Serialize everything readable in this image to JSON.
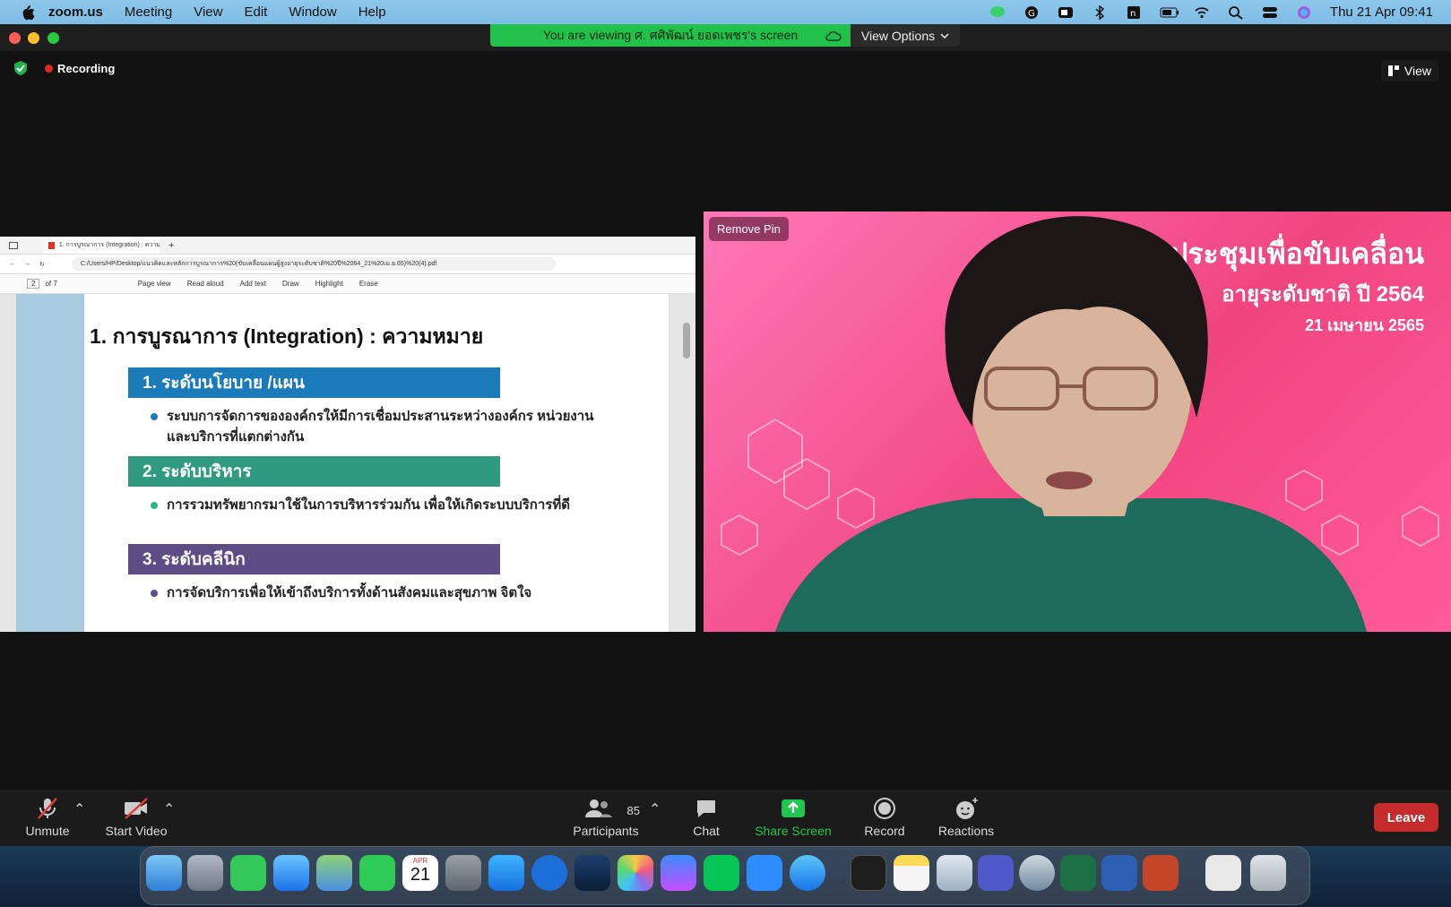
{
  "menubar": {
    "app_name": "zoom.us",
    "menus": [
      "Meeting",
      "View",
      "Edit",
      "Window",
      "Help"
    ],
    "clock": "Thu 21 Apr  09:41"
  },
  "zoom": {
    "banner": "You are viewing ศ. ศศิพัฒน์ ยอดเพชร's screen",
    "view_options": "View Options",
    "recording": "Recording",
    "view_button": "View",
    "remove_pin": "Remove Pin"
  },
  "shared_screen": {
    "url": "C:/Users/HP/Desktop/แนวคิดและหลักการบูรณาการ%20(ขับเคลื่อนแผนผู้สูงอายุระดับชาติ%20ปี%2064_21%20เม.ย.65)%20(4).pdf",
    "page": "2",
    "page_total": "of 7",
    "pdf_tools": [
      "Page view",
      "Read aloud",
      "Add text",
      "Draw",
      "Highlight",
      "Erase"
    ],
    "slide_title": "1. การบูรณาการ (Integration) : ความหมาย",
    "sections": [
      {
        "heading": "1. ระดับนโยบาย /แผน",
        "color": "#1b7ab8",
        "bullet": "ระบบการจัดการขององค์กรให้มีการเชื่อมประสานระหว่างองค์กร หน่วยงาน และบริการที่แตกต่างกัน",
        "bullet_color": "#1b7ab8"
      },
      {
        "heading": "2. ระดับบริหาร",
        "color": "#2f9a7f",
        "bullet": "การรวมทรัพยากรมาใช้ในการบริหารร่วมกัน เพื่อให้เกิดระบบบริการที่ดี",
        "bullet_color": "#2fb58a"
      },
      {
        "heading": "3. ระดับคลีนิก",
        "color": "#5e4c86",
        "bullet": "การจัดบริการเพื่อให้เข้าถึงบริการทั้งด้านสังคมและสุขภาพ จิตใจ",
        "bullet_color": "#5e4c86"
      }
    ]
  },
  "video": {
    "bg_line1": "ประชุมเพื่อขับเคลื่อน",
    "bg_line2": "อายุระดับชาติ ปี 2564",
    "bg_line3": "21 เมษายน 2565"
  },
  "controls": {
    "unmute": "Unmute",
    "start_video": "Start Video",
    "participants": "Participants",
    "participant_count": "85",
    "chat": "Chat",
    "share_screen": "Share Screen",
    "record": "Record",
    "reactions": "Reactions",
    "leave": "Leave"
  },
  "dock": {
    "calendar_month": "APR",
    "calendar_day": "21"
  }
}
